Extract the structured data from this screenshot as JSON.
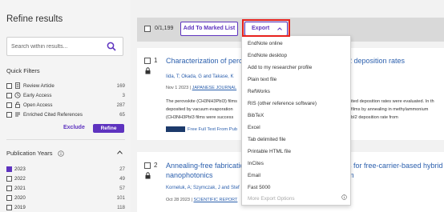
{
  "sidebar": {
    "title": "Refine results",
    "search_placeholder": "Search within results...",
    "quick_filters_title": "Quick Filters",
    "quick_filters": [
      {
        "label": "Review Article",
        "count": "169"
      },
      {
        "label": "Early Access",
        "count": "3"
      },
      {
        "label": "Open Access",
        "count": "287"
      },
      {
        "label": "Enriched Cited References",
        "count": "65"
      }
    ],
    "exclude_label": "Exclude",
    "refine_label": "Refine",
    "publication_years_title": "Publication Years",
    "years": [
      {
        "label": "2023",
        "count": "27",
        "checked": true
      },
      {
        "label": "2022",
        "count": "49",
        "checked": false
      },
      {
        "label": "2021",
        "count": "57",
        "checked": false
      },
      {
        "label": "2020",
        "count": "101",
        "checked": false
      },
      {
        "label": "2019",
        "count": "118",
        "checked": false
      }
    ]
  },
  "toolbar": {
    "selected_count": "0/1,199",
    "marked_label": "Add To Marked List",
    "export_label": "Export"
  },
  "results": [
    {
      "num": "1",
      "title_line1": "Characterization of perov",
      "title_suffix": "2 deposition rates",
      "authors": "Iida, T; Okada, G and Takase, K",
      "date": "Nov 1 2023 |",
      "journal": "JAPANESE JOURNAL",
      "abstract_line1": "The perovskite (CH3NH3PbI3) films",
      "abstract_line1_right": "ited deposition rates were evaluated. In th",
      "abstract_line2": "deposited by vacuum evaporation",
      "abstract_line2_right": "films by annealing in methylammonium",
      "abstract_line3": "(CH3NH3PbI3 films were success",
      "abstract_line3_right": "bI2 deposition rate from",
      "full_text": "Free Full Text From Pub"
    },
    {
      "num": "2",
      "title_line1": "Annealing-free fabricatio",
      "title_line1_right": "s for free-carrier-based hybrid m",
      "title_line2": "nanophotonics",
      "authors": "Korneluk, A; Szymczak, J and Stef",
      "date": "Oct 28 2023 |",
      "journal": "SCIENTIFIC REPORT"
    }
  ],
  "export_menu": [
    "EndNote online",
    "EndNote desktop",
    "Add to my researcher profile",
    "Plain text file",
    "RefWorks",
    "RIS (other reference software)",
    "BibTeX",
    "Excel",
    "Tab delimited file",
    "Printable HTML file",
    "InCites",
    "Email",
    "Fast 5000",
    "More Export Options"
  ],
  "colors": {
    "accent": "#5e33bf",
    "link": "#2b5fad",
    "highlight": "#e8211d"
  }
}
